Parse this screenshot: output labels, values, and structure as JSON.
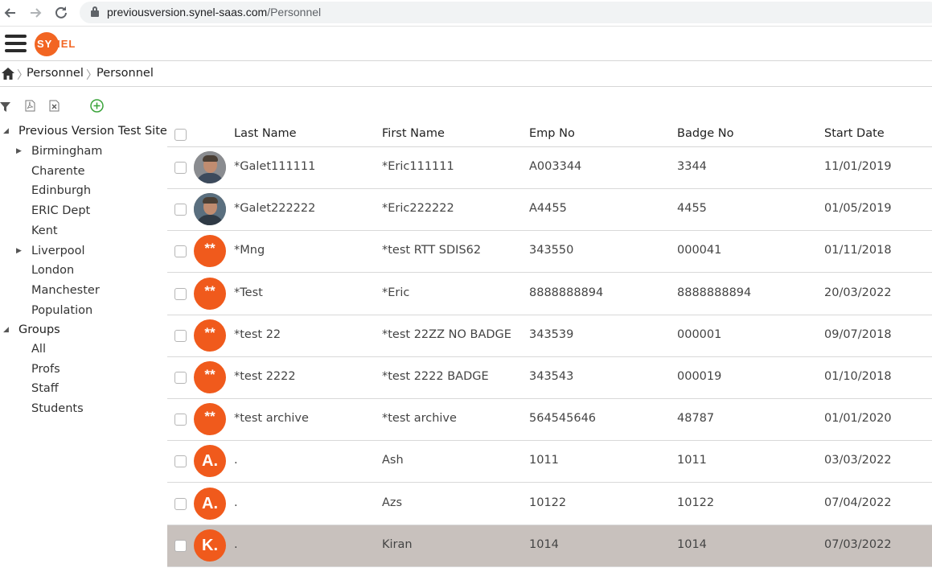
{
  "browser": {
    "url_domain": "previousversion.synel-saas.com",
    "url_path": "/Personnel"
  },
  "header": {
    "logo_text_a": "SY",
    "logo_text_b": "NEL"
  },
  "breadcrumb": {
    "items": [
      "Personnel",
      "Personnel"
    ]
  },
  "tree": {
    "sites_root": "Previous Version Test Site",
    "sites": [
      {
        "label": "Birmingham",
        "expandable": true
      },
      {
        "label": "Charente",
        "expandable": false
      },
      {
        "label": "Edinburgh",
        "expandable": false
      },
      {
        "label": "ERIC Dept",
        "expandable": false
      },
      {
        "label": "Kent",
        "expandable": false
      },
      {
        "label": "Liverpool",
        "expandable": true
      },
      {
        "label": "London",
        "expandable": false
      },
      {
        "label": "Manchester",
        "expandable": false
      },
      {
        "label": "Population",
        "expandable": false
      }
    ],
    "groups_root": "Groups",
    "groups": [
      {
        "label": "All"
      },
      {
        "label": "Profs"
      },
      {
        "label": "Staff"
      },
      {
        "label": "Students"
      }
    ]
  },
  "table": {
    "columns": [
      "Last Name",
      "First Name",
      "Emp No",
      "Badge No",
      "Start Date"
    ],
    "rows": [
      {
        "avatar": "photo",
        "initials": "",
        "last": "*Galet111111",
        "first": "*Eric111111",
        "emp": "A003344",
        "badge": "3344",
        "start": "11/01/2019",
        "selected": false
      },
      {
        "avatar": "photo2",
        "initials": "",
        "last": "*Galet222222",
        "first": "*Eric222222",
        "emp": "A4455",
        "badge": "4455",
        "start": "01/05/2019",
        "selected": false
      },
      {
        "avatar": "initials",
        "initials": "**",
        "last": "*Mng",
        "first": "*test RTT SDIS62",
        "emp": "343550",
        "badge": "000041",
        "start": "01/11/2018",
        "selected": false
      },
      {
        "avatar": "initials",
        "initials": "**",
        "last": "*Test",
        "first": "*Eric",
        "emp": "8888888894",
        "badge": "8888888894",
        "start": "20/03/2022",
        "selected": false
      },
      {
        "avatar": "initials",
        "initials": "**",
        "last": "*test 22",
        "first": "*test 22ZZ NO BADGE",
        "emp": "343539",
        "badge": "000001",
        "start": "09/07/2018",
        "selected": false
      },
      {
        "avatar": "initials",
        "initials": "**",
        "last": "*test 2222",
        "first": "*test 2222 BADGE",
        "emp": "343543",
        "badge": "000019",
        "start": "01/10/2018",
        "selected": false
      },
      {
        "avatar": "initials",
        "initials": "**",
        "last": "*test archive",
        "first": "*test archive",
        "emp": "564545646",
        "badge": "48787",
        "start": "01/01/2020",
        "selected": false
      },
      {
        "avatar": "initials",
        "initials": "A.",
        "last": ".",
        "first": "Ash",
        "emp": "1011",
        "badge": "1011",
        "start": "03/03/2022",
        "selected": false
      },
      {
        "avatar": "initials",
        "initials": "A.",
        "last": ".",
        "first": "Azs",
        "emp": "10122",
        "badge": "10122",
        "start": "07/04/2022",
        "selected": false
      },
      {
        "avatar": "initials",
        "initials": "K.",
        "last": ".",
        "first": "Kiran",
        "emp": "1014",
        "badge": "1014",
        "start": "07/03/2022",
        "selected": true
      }
    ]
  },
  "colors": {
    "brand": "#f26522",
    "avatar": "#f05a1c",
    "selected_row": "#c8c1bd",
    "add_icon": "#3aa33a"
  },
  "icons": [
    "back-icon",
    "forward-icon",
    "reload-icon",
    "lock-icon",
    "menu-icon",
    "home-icon",
    "filter-icon",
    "pdf-icon",
    "excel-icon",
    "add-icon"
  ]
}
